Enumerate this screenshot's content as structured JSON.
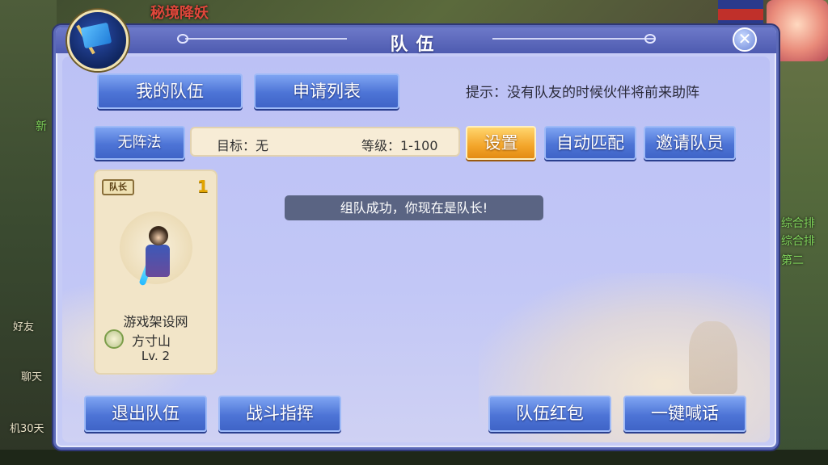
{
  "background": {
    "top_banner": "秘境降妖",
    "left_labels": [
      "新",
      "好友",
      "聊天",
      "机30天"
    ],
    "right_labels": [
      "综合排",
      "综合排",
      "第二"
    ]
  },
  "panel": {
    "title": "队伍",
    "close_glyph": "✕"
  },
  "tabs": {
    "my_team": "我的队伍",
    "apply_list": "申请列表"
  },
  "tip": "提示：没有队友的时候伙伴将前来助阵",
  "formation_button": "无阵法",
  "target": {
    "label": "目标：无",
    "level": "等级：1-100"
  },
  "actions": {
    "settings": "设置",
    "auto_match": "自动匹配",
    "invite": "邀请队员"
  },
  "member": {
    "leader_tag": "队长",
    "slot": "1",
    "name": "游戏架设网",
    "school": "方寸山",
    "level": "Lv. 2"
  },
  "toast": "组队成功，你现在是队长!",
  "bottom_buttons": {
    "leave_team": "退出队伍",
    "battle_command": "战斗指挥",
    "team_red_packet": "队伍红包",
    "one_key_shout": "一键喊话"
  },
  "colors": {
    "panel_bg": "#c6cbf6",
    "button_blue": "#4d74d6",
    "button_orange": "#f3a52a",
    "toast_bg": "#5a6483"
  }
}
